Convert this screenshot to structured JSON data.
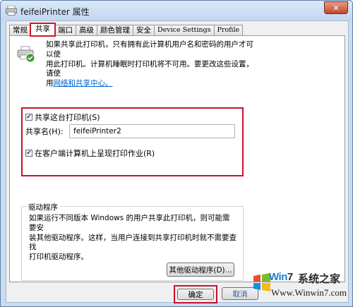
{
  "window": {
    "title": "feifeiPrinter 属性",
    "close_label": "✕"
  },
  "tabs": [
    {
      "label": "常规"
    },
    {
      "label": "共享"
    },
    {
      "label": "端口"
    },
    {
      "label": "高级"
    },
    {
      "label": "颜色管理"
    },
    {
      "label": "安全"
    },
    {
      "label": "Device Settings"
    },
    {
      "label": "Profile"
    }
  ],
  "active_tab": "共享",
  "description": {
    "line1": "如果共享此打印机，只有拥有此计算机用户名和密码的用户才可以使",
    "line2": "用此打印机。计算机睡眠时打印机将不可用。要更改这些设置，请使",
    "line3_prefix": "用",
    "link_text": "网络和共享中心。"
  },
  "share": {
    "share_checkbox_label": "共享这台打印机(S)",
    "share_checked": true,
    "share_name_label": "共享名(H):",
    "share_name_value": "feifeiPrinter2",
    "render_checkbox_label": "在客户端计算机上呈现打印作业(R)",
    "render_checked": true
  },
  "drivers": {
    "legend": "驱动程序",
    "line1": "如果运行不同版本 Windows 的用户共享此打印机，则可能需要安",
    "line2": "装其他驱动程序。这样，当用户连接到共享打印机时就不需要查找",
    "line3": "打印机驱动程序。",
    "button_label": "其他驱动程序(D)..."
  },
  "footer": {
    "ok_label": "确定",
    "cancel_label": "取消"
  },
  "watermark": {
    "brand_win": "Win",
    "brand_7": "7",
    "brand_cn": "系统之家",
    "url": "Www.Winwin7.com"
  },
  "colors": {
    "highlight_border": "#c8102e",
    "link": "#0066cc",
    "title_bar": "#c3d7f0"
  }
}
